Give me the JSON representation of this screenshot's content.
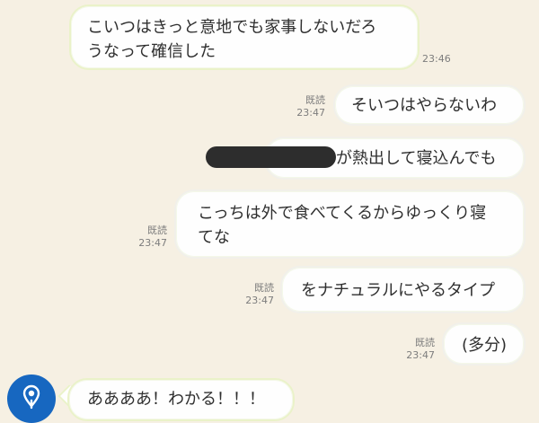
{
  "conversation": {
    "messages": [
      {
        "text": "こいつはきっと意地でも家事しないだろ\nうなって確信した",
        "time": "23:46"
      },
      {
        "read_label": "既読",
        "text": "そいつはやらないわ",
        "time": "23:47"
      },
      {
        "text": "が熱出して寝込んでも"
      },
      {
        "read_label": "既読",
        "text": "こっちは外で食べてくるからゆっくり寝\nてな",
        "time": "23:47"
      },
      {
        "read_label": "既読",
        "text": "をナチュラルにやるタイプ",
        "time": "23:47"
      },
      {
        "read_label": "既読",
        "text": "(多分)",
        "time": "23:47"
      },
      {
        "text": "ああああ！わかる！！！"
      }
    ]
  },
  "icons": {
    "avatar": "location-pin-icon"
  },
  "colors": {
    "background": "#f6f0e3",
    "avatar": "#1767c0",
    "redaction": "#2d2d2d"
  }
}
